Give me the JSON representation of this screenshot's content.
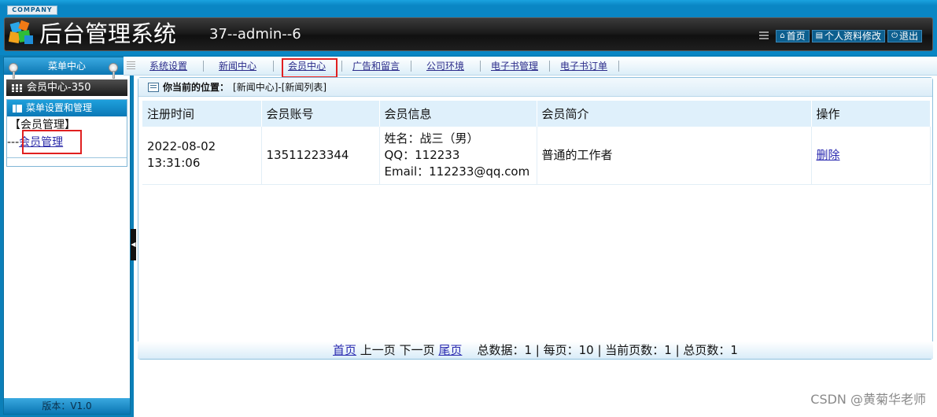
{
  "header": {
    "company": "COMPANY",
    "title": "后台管理系统",
    "user_info": "37--admin--6",
    "links": [
      {
        "icon": "home-icon",
        "label": "首页"
      },
      {
        "icon": "profile-icon",
        "label": "个人资料修改"
      },
      {
        "icon": "power-icon",
        "label": "退出"
      }
    ]
  },
  "sidebar": {
    "heading": "菜单中心",
    "member_center": "会员中心-350",
    "section_title": "菜单设置和管理",
    "group": "【会员管理】",
    "link_prefix": "---",
    "link": "会员管理",
    "version": "版本：V1.0"
  },
  "tabs": [
    "系统设置",
    "新闻中心",
    "会员中心",
    "广告和留言",
    "公司环境",
    "电子书管理",
    "电子书订单"
  ],
  "breadcrumb": {
    "label": "你当前的位置：",
    "path": "[新闻中心]-[新闻列表]"
  },
  "table": {
    "headers": [
      "注册时间",
      "会员账号",
      "会员信息",
      "会员简介",
      "操作"
    ],
    "rows": [
      {
        "time_date": "2022-08-02",
        "time_clock": "13:31:06",
        "account": "13511223344",
        "info_name": "姓名：战三（男）",
        "info_qq": "QQ：112233",
        "info_email": "Email：112233@qq.com",
        "intro": "普通的工作者",
        "action": "删除"
      }
    ]
  },
  "pager": {
    "first": "首页",
    "prev": "上一页",
    "next": "下一页",
    "last": "尾页",
    "summary": "总数据：1 | 每页：10 | 当前页数：1 | 总页数：1"
  },
  "watermark": "CSDN @黄菊华老师",
  "colors": {
    "frame_blue": "#0b7fb8",
    "header_dark": "#1c1c1c",
    "highlight_red": "#e02020",
    "link_blue": "#2a2ab0"
  }
}
